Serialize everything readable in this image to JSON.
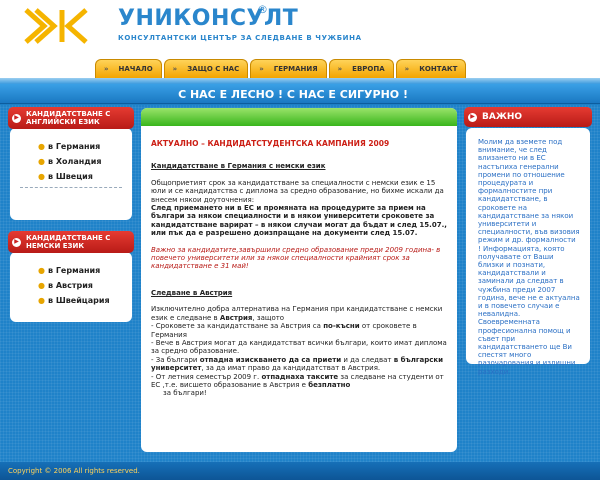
{
  "brand": {
    "name": "УНИКОНСУЛТ",
    "reg": "®",
    "tagline": "КОНСУЛТАНТСКИ ЦЕНТЪР ЗА СЛЕДВАНЕ В ЧУЖБИНА",
    "logo_colors": [
      "#f5b400",
      "#2a86cc"
    ]
  },
  "nav": [
    {
      "label": "НАЧАЛО"
    },
    {
      "label": "ЗАЩО С НАС"
    },
    {
      "label": "ГЕРМАНИЯ"
    },
    {
      "label": "ЕВРОПА"
    },
    {
      "label": "КОНТАКТ"
    }
  ],
  "slogan": "С НАС Е ЛЕСНО !  С НАС Е СИГУРНО !",
  "left_boxes": [
    {
      "title": "КАНДИДАТСТВАНЕ С АНГЛИЙСКИ ЕЗИК",
      "links": [
        "в Германия",
        "в Холандия",
        "в Швеция"
      ]
    },
    {
      "title": "КАНДИДАТСТВАНЕ С НЕМСКИ ЕЗИК",
      "links": [
        "в Германия",
        "в Австрия",
        "в Швейцария"
      ]
    }
  ],
  "content": {
    "title": "АКТУАЛНО – КАНДИДАТСТУДЕНТСКА КАМПАНИЯ 2009",
    "sub1": "Кандидатстване в Германия с немски език",
    "p1": "Общоприетият срок за кандидатстване за специалности с немски език е 15 юли и се кандидатства с диплома за средно образование, но бихме искали да внесем някои доуточнения:",
    "p1_bold": "След приемането ни в ЕС и промяната на процедурите за прием на българи за някои специалности и в някои университети сроковете за кандидатстване варират – в някои случаи могат да бъдат и след 15.07., или пък да е разрешено доизпращане на документи след 15.07.",
    "p2": "Важно за кандидатите,завършили средно образование преди 2009 година- в повечето университети или за някои специалности крайният срок за кандидатстване е 31 май!",
    "sub2": "Следване в Австрия",
    "p3_a": "Изключително добра алтернатива на Германия при кандидатстване с немски език е следване в",
    "p3_b": "Австрия",
    "p3_c": ", защото",
    "l1_a": "-  Сроковете за кандидатстване за Австрия са",
    "l1_b": "по-късни",
    "l1_c": "от сроковете    в Германия",
    "l2": "-  Вече в Австрия могат да кандидатстват всички българи, които имат диплома за средно образование.",
    "l3_a": "-  За българи",
    "l3_b": "отпадна изискването да са приети",
    "l3_c": "и да следват",
    "l3_d": "в български университет",
    "l3_e": ", за да имат право да кандидатстват в Австрия.",
    "l4_a": "-  От летния семестър 2009 г.",
    "l4_b": "отпаднаха таксите",
    "l4_c": "за следване на студенти от ЕС ,т.е. висшето образование в Австрия е",
    "l4_d": "безплатно",
    "l4_e": "за българи!"
  },
  "right_box": {
    "title": "ВАЖНО",
    "text": "Молим да вземете под внимание, че след влизането ни в ЕС настъпиха генерални промени по отношение процедурата и формалностите при кандидатстване, в сроковете на кандидатстване за някои университети и специалности, във визовия режим и др. формалности ! Информацията, която получавате от Ваши близки и познати, кандидатствали и заминали да следват в чужбина преди 2007 година, вече не е актуална и в повечето случаи е невалидна. Своевременната професионална помощ и съвет при кандидатстването ще Ви спестят много разочарования и излишни разходи."
  },
  "footer": "Copyright © 2006 All rights reserved."
}
